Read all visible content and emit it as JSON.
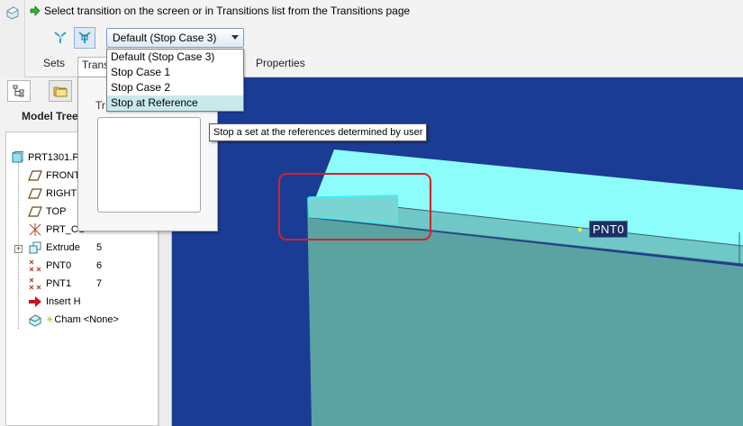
{
  "message": "Select transition on the screen or in Transitions list from the Transitions page",
  "combo": {
    "selected": "Default (Stop Case 3)"
  },
  "dropdown": {
    "options": [
      "Default (Stop Case 3)",
      "Stop Case 1",
      "Stop Case 2",
      "Stop at Reference"
    ],
    "highlighted_index": 3
  },
  "tooltip": "Stop a set at the references determined by user",
  "tabs": {
    "sets": "Sets",
    "transitions": "Trans",
    "properties": "Properties"
  },
  "panel": {
    "label": "Tr"
  },
  "navigator": {
    "title": "Model Tree"
  },
  "tree": [
    {
      "label": "PRT1301.P",
      "num": "",
      "icon": "part-icon"
    },
    {
      "label": "FRONT",
      "num": "",
      "icon": "datum-plane-icon"
    },
    {
      "label": "RIGHT",
      "num": "",
      "icon": "datum-plane-icon"
    },
    {
      "label": "TOP",
      "num": "",
      "icon": "datum-plane-icon"
    },
    {
      "label": "PRT_CS",
      "num": "",
      "icon": "coordinate-system-icon"
    },
    {
      "label": "Extrude",
      "num": "5",
      "icon": "extrude-icon"
    },
    {
      "label": "PNT0",
      "num": "6",
      "icon": "datum-point-icon"
    },
    {
      "label": "PNT1",
      "num": "7",
      "icon": "datum-point-icon"
    },
    {
      "label": "Insert H",
      "num": "",
      "icon": "insert-here-arrow-icon"
    },
    {
      "label": "Cham <None>",
      "num": "",
      "icon": "chamfer-icon"
    }
  ],
  "viewport": {
    "point_label": "PNT0"
  },
  "colors": {
    "viewport_bg": "#1b3c95",
    "model_top": "#8cfdfb",
    "model_front": "#5aa3a0",
    "highlight": "#cfeef0",
    "selection_box": "#d81f2a"
  }
}
